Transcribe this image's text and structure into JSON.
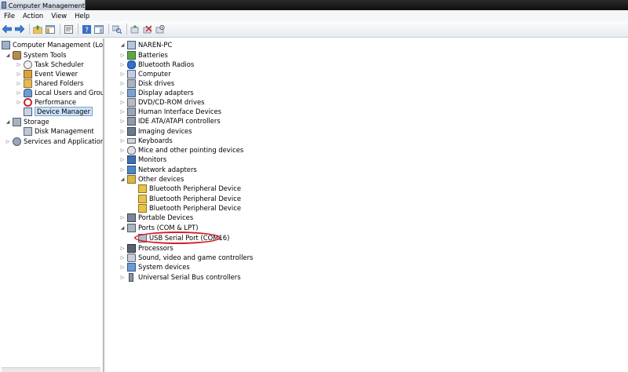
{
  "window": {
    "title": "Computer Management"
  },
  "menu": [
    "File",
    "Action",
    "View",
    "Help"
  ],
  "colors": {
    "selection_bg": "#cce2f7",
    "annotation": "#d11f2a"
  },
  "left_tree": {
    "root": "Computer Management (Local",
    "system_tools": "System Tools",
    "task_scheduler": "Task Scheduler",
    "event_viewer": "Event Viewer",
    "shared_folders": "Shared Folders",
    "local_users": "Local Users and Groups",
    "performance": "Performance",
    "device_manager": "Device Manager",
    "storage": "Storage",
    "disk_management": "Disk Management",
    "services": "Services and Applications"
  },
  "device_tree": {
    "root": "NAREN-PC",
    "categories": {
      "batteries": "Batteries",
      "bluetooth_radios": "Bluetooth Radios",
      "computer": "Computer",
      "disk_drives": "Disk drives",
      "display_adapters": "Display adapters",
      "dvd": "DVD/CD-ROM drives",
      "hid": "Human Interface Devices",
      "ide": "IDE ATA/ATAPI controllers",
      "imaging": "Imaging devices",
      "keyboards": "Keyboards",
      "mice": "Mice and other pointing devices",
      "monitors": "Monitors",
      "network": "Network adapters",
      "other": "Other devices",
      "portable": "Portable Devices",
      "ports": "Ports (COM & LPT)",
      "processors": "Processors",
      "sound": "Sound, video and game controllers",
      "system": "System devices",
      "usb": "Universal Serial Bus controllers"
    },
    "other_children": [
      "Bluetooth Peripheral Device",
      "Bluetooth Peripheral Device",
      "Bluetooth Peripheral Device"
    ],
    "ports_child": "USB Serial Port (COM16)"
  }
}
